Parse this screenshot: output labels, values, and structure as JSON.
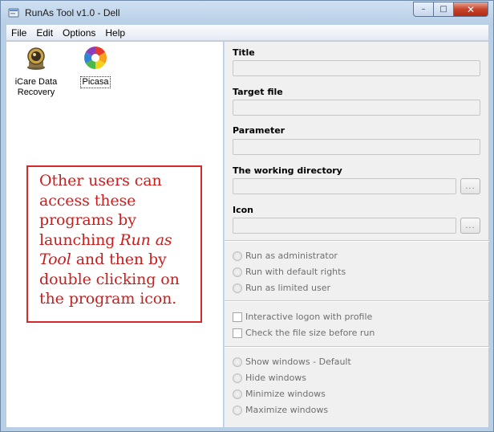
{
  "window": {
    "title": "RunAs Tool v1.0 - Dell",
    "minimize_label": "–",
    "maximize_label": "□",
    "close_label": "✕"
  },
  "menu": [
    {
      "label": "File"
    },
    {
      "label": "Edit"
    },
    {
      "label": "Options"
    },
    {
      "label": "Help"
    }
  ],
  "programs": [
    {
      "label_line1": "iCare Data",
      "label_line2": "Recovery",
      "icon": "icare-data-recovery-icon"
    },
    {
      "label": "Picasa",
      "icon": "picasa-icon",
      "selected": true
    }
  ],
  "note": {
    "part1": "Other users can access these programs by launching ",
    "emphasis": "Run as Tool",
    "part2": " and then by double clicking on the program icon."
  },
  "form": {
    "title_label": "Title",
    "target_label": "Target file",
    "parameter_label": "Parameter",
    "workdir_label": "The working directory",
    "icon_label": "Icon",
    "browse_label": "..."
  },
  "rights_options": [
    "Run as administrator",
    "Run with default rights",
    "Run as limited user"
  ],
  "check_options": [
    "Interactive logon with profile",
    "Check the file size before run"
  ],
  "window_options": [
    "Show windows - Default",
    "Hide windows",
    "Minimize windows",
    "Maximize windows"
  ],
  "colors": {
    "note_text": "#c81e1e",
    "note_border": "#d52a2a",
    "pane_bg": "#f0f0f0",
    "close_button": "#c8432b"
  }
}
